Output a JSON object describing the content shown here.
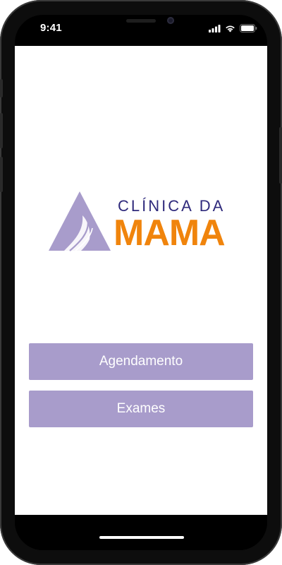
{
  "status_bar": {
    "time": "9:41",
    "icons": [
      "cellular-signal-icon",
      "wifi-icon",
      "battery-icon"
    ]
  },
  "logo": {
    "line1": "CLÍNICA DA",
    "line2": "MAMA",
    "colors": {
      "text_line1": "#2f2a7c",
      "text_line2": "#f0840c",
      "mark": "#a89ccb"
    }
  },
  "menu": {
    "buttons": [
      {
        "label": "Agendamento"
      },
      {
        "label": "Exames"
      }
    ]
  },
  "colors": {
    "button_background": "#a89ccb",
    "button_text": "#ffffff",
    "screen_background": "#ffffff",
    "device_frame": "#0d0d0d"
  }
}
